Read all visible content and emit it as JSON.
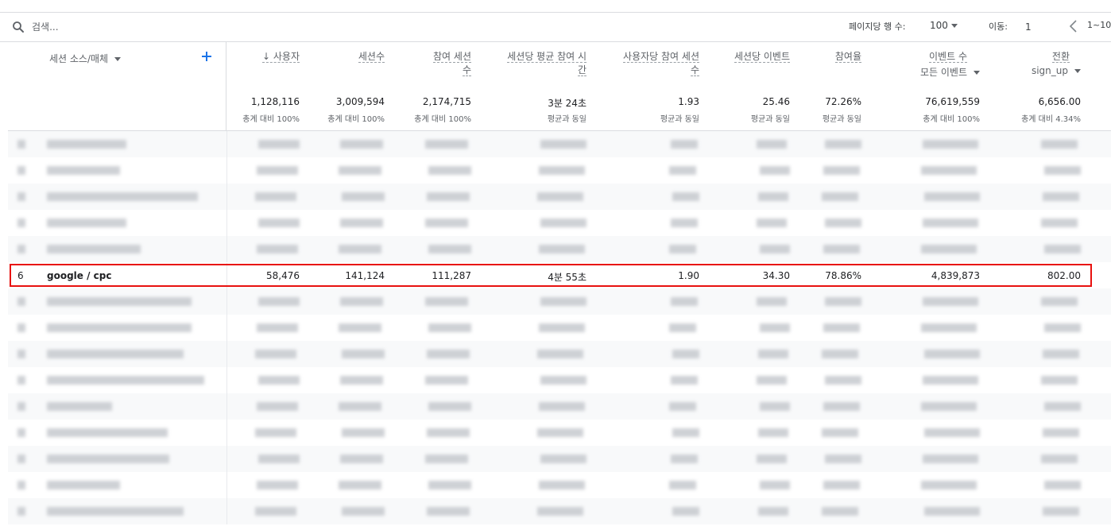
{
  "toolbar": {
    "search_placeholder": "검색...",
    "rows_per_page_label": "페이지당 행 수:",
    "rows_per_page_value": "100",
    "goto_label": "이동:",
    "goto_value": "1",
    "page_range": "1~10"
  },
  "header": {
    "dimension": "세션 소스/매체",
    "metrics": [
      {
        "label": "↓ 사용자",
        "total": "1,128,116",
        "compare": "총계 대비 100%"
      },
      {
        "label": "세션수",
        "total": "3,009,594",
        "compare": "총계 대비 100%"
      },
      {
        "label": "참여 세션 수",
        "total": "2,174,715",
        "compare": "총계 대비 100%"
      },
      {
        "label": "세션당 평균 참여 시간",
        "total": "3분 24초",
        "compare": "평균과 동일"
      },
      {
        "label": "사용자당 참여 세션수",
        "total": "1.93",
        "compare": "평균과 동일"
      },
      {
        "label": "세션당 이벤트",
        "total": "25.46",
        "compare": "평균과 동일"
      },
      {
        "label": "참여율",
        "total": "72.26%",
        "compare": "평균과 동일"
      },
      {
        "label": "이벤트 수",
        "sub": "모든 이벤트",
        "total": "76,619,559",
        "compare": "총계 대비 100%"
      },
      {
        "label": "전환",
        "sub": "sign_up",
        "total": "6,656.00",
        "compare": "총계 대비 4.34%"
      }
    ]
  },
  "highlighted_row": {
    "rank": "6",
    "dimension": "google / cpc",
    "values": [
      "58,476",
      "141,124",
      "111,287",
      "4분 55초",
      "1.90",
      "34.30",
      "78.86%",
      "4,839,873",
      "802.00"
    ]
  },
  "colors": {
    "highlight_border": "#e8110f",
    "add_button": "#1a73e8",
    "text_secondary": "#5f6368"
  }
}
